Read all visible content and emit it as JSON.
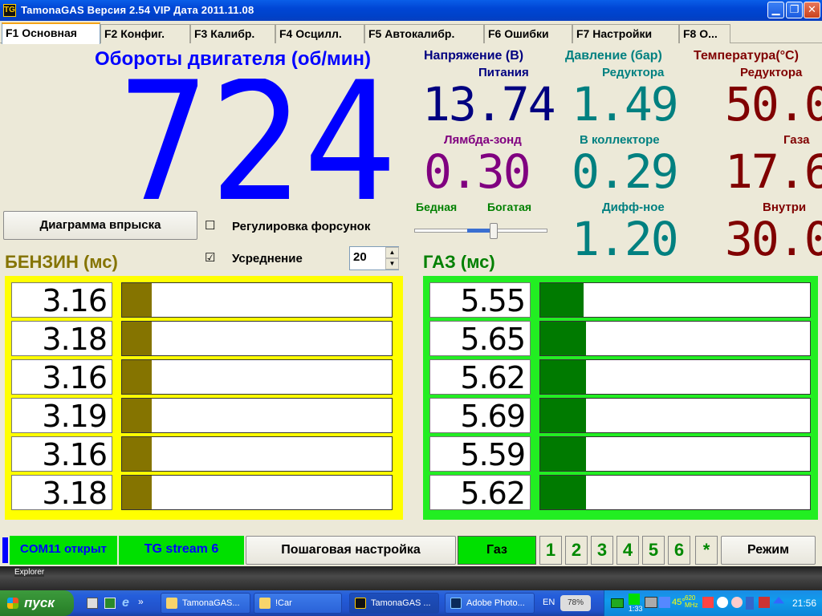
{
  "window": {
    "title": "TamonaGAS  Версия 2.54 VIP  Дата 2011.11.08",
    "icon_text": "TG"
  },
  "tabs": [
    "F1 Основная",
    "F2 Конфиг.",
    "F3 Калибр.",
    "F4 Осцилл.",
    "F5 Автокалибр.",
    "F6 Ошибки",
    "F7 Настройки",
    "F8 О..."
  ],
  "rpm": {
    "title": "Обороты двигателя (об/мин)",
    "value": "724"
  },
  "voltage": {
    "header": "Напряжение (В)",
    "supply_label": "Питания",
    "supply_value": "13.74",
    "lambda_label": "Лямбда-зонд",
    "lambda_value": "0.30",
    "lean_label": "Бедная",
    "rich_label": "Богатая",
    "lambda_slider_fraction": 0.6
  },
  "pressure": {
    "header": "Давление (бар)",
    "reducer_label": "Редуктора",
    "reducer_value": "1.49",
    "collector_label": "В коллекторе",
    "collector_value": "0.29",
    "diff_label": "Дифф-ное",
    "diff_value": "1.20"
  },
  "temperature": {
    "header": "Температура(°C)",
    "reducer_label": "Редуктора",
    "reducer_value": "50.0",
    "gas_label": "Газа",
    "gas_value": "17.6",
    "inside_label": "Внутри",
    "inside_value": "30.0"
  },
  "controls": {
    "diagram_button": "Диаграмма впрыска",
    "injector_adjust_label": "Регулировка форсунок",
    "injector_adjust_checked": "☐",
    "averaging_label": "Усреднение",
    "averaging_checked": "☑",
    "averaging_value": "20"
  },
  "petrol": {
    "title": "БЕНЗИН (мс)",
    "values": [
      "3.16",
      "3.18",
      "3.16",
      "3.19",
      "3.16",
      "3.18"
    ],
    "fill": [
      0.11,
      0.11,
      0.11,
      0.11,
      0.11,
      0.11
    ],
    "color": "#857400",
    "panel_color": "#ffff00"
  },
  "gas": {
    "title": "ГАЗ (мс)",
    "values": [
      "5.55",
      "5.65",
      "5.62",
      "5.69",
      "5.59",
      "5.62"
    ],
    "fill": [
      0.16,
      0.17,
      0.17,
      0.17,
      0.17,
      0.17
    ],
    "color": "#007a00",
    "panel_color": "#22ee22"
  },
  "status": {
    "com": "COM11 открыт",
    "stream": "TG stream 6",
    "step_button": "Пошаговая настройка",
    "mode_indicator": "Газ",
    "numbers": [
      "1",
      "2",
      "3",
      "4",
      "5",
      "6"
    ],
    "star": "*",
    "mode_button": "Режим"
  },
  "taskbar": {
    "start": "пуск",
    "tasks": [
      "TamonaGAS...",
      "!Car",
      "TamonaGAS ...",
      "Adobe Photo..."
    ],
    "lang": "EN",
    "battery": "78%",
    "tray_temp": "45°",
    "tray_freq": "620 MHz",
    "tray_time_small": "1:33",
    "clock": "21:56",
    "hidden_label": "Explorer"
  },
  "colors": {
    "rpm": "#0000ff",
    "voltage": "#000080",
    "lambda": "#800080",
    "pressure": "#008080",
    "temperature": "#800000",
    "green_label": "#008000",
    "petrol_title": "#857400"
  }
}
